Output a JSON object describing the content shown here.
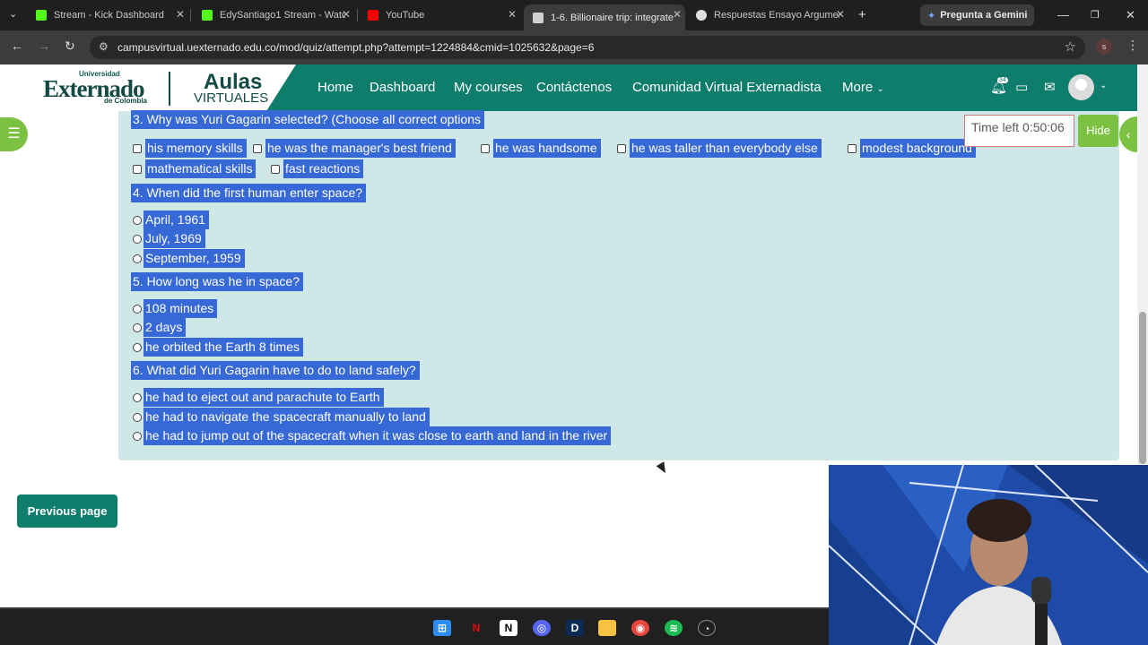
{
  "browser": {
    "tabs": [
      {
        "title": "Stream - Kick Dashboard",
        "favicon_color": "#53fc18",
        "favicon": "kick-icon"
      },
      {
        "title": "EdySantiago1 Stream - Watc",
        "favicon_color": "#53fc18",
        "favicon": "kick-icon"
      },
      {
        "title": "YouTube",
        "favicon_color": "#ff0000",
        "favicon": "youtube-icon"
      },
      {
        "title": "1-6. Billionaire trip: integrate",
        "favicon_color": "#d0d0d0",
        "favicon": "moodle-icon",
        "active": true
      },
      {
        "title": "Respuestas Ensayo Argumen",
        "favicon_color": "#e0e0e0",
        "favicon": "chatgpt-icon"
      }
    ],
    "gemini_label": "Pregunta a Gemini",
    "url": "campusvirtual.uexternado.edu.co/mod/quiz/attempt.php?attempt=1224884&cmid=1025632&page=6",
    "profile_initial": "s"
  },
  "site": {
    "logo": {
      "universidad": "Universidad",
      "externado": "Externado",
      "de_colombia": "de Colombia",
      "aulas": "Aulas",
      "virtuales": "VIRTUALES"
    },
    "nav": [
      "Home",
      "Dashboard",
      "My courses",
      "Contáctenos",
      "Comunidad Virtual Externadista",
      "More"
    ],
    "notification_count": "34",
    "brand_color": "#0f7d6b"
  },
  "quiz": {
    "q3": {
      "question": "3. Why was Yuri Gagarin selected? (Choose all correct options",
      "options": [
        "his memory skills",
        "he was the manager's best friend",
        "he was handsome",
        "he was taller than everybody else",
        "modest background",
        "mathematical skills",
        "fast reactions"
      ]
    },
    "q4": {
      "question": "4. When did the first human enter space?",
      "options": [
        "April, 1961",
        "July, 1969",
        "September, 1959"
      ]
    },
    "q5": {
      "question": "5. How long was he in space?",
      "options": [
        "108 minutes",
        "2 days",
        "he orbited the Earth 8 times"
      ]
    },
    "q6": {
      "question": "6. What did Yuri Gagarin have to do to land safely?",
      "options": [
        "he had to eject out and parachute to Earth",
        "he had to navigate the spacecraft manually to land",
        "he had to jump out of the spacecraft when it was close to earth and land in the river"
      ]
    },
    "timer": "Time left 0:50:06",
    "hide_label": "Hide",
    "previous_label": "Previous page",
    "selection_color": "#3769d6"
  }
}
